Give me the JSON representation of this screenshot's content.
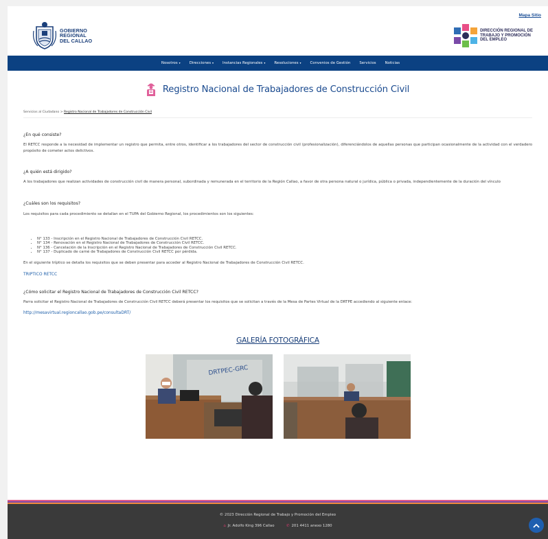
{
  "topbar": {
    "sitemap": "Mapa Sitio"
  },
  "header": {
    "left_logo": [
      "GOBIERNO",
      "REGIONAL",
      "DEL CALLAO"
    ],
    "right_logo": [
      "DIRECCIÓN REGIONAL DE",
      "TRABAJO Y PROMOCIÓN",
      "DEL EMPLEO"
    ]
  },
  "nav": [
    {
      "label": "Nosotros",
      "dropdown": true
    },
    {
      "label": "Direcciones",
      "dropdown": true
    },
    {
      "label": "Instancias Regionales",
      "dropdown": true
    },
    {
      "label": "Resoluciones",
      "dropdown": true
    },
    {
      "label": "Convenios de Gestión",
      "dropdown": false
    },
    {
      "label": "Servicios",
      "dropdown": false
    },
    {
      "label": "Noticias",
      "dropdown": false
    }
  ],
  "page": {
    "title": "Registro Nacional de Trabajadores de Construcción Civil",
    "breadcrumb_root": "Servicios al Ciudadano",
    "breadcrumb_sep": ">",
    "breadcrumb_current": "Registro Nacional de Trabajadores de Construcción Civil"
  },
  "sections": {
    "q1": "¿En qué consiste?",
    "p1": "El RETCC responde a la necesidad de implementar un registro que permita, entre otros, identificar a los trabajadores del sector de construcción civil (profesionalización), diferenciándolos de aquellas personas que participan ocasionalmente de la actividad con el verdadero propósito de cometer actos delictivos.",
    "q2": "¿A quién está dirigido?",
    "p2": "A los trabajadores que realizan actividades de construcción civil de manera personal, subordinada y remunerada en el territorio de la Región Callao, a favor de otra persona natural o jurídica, pública o privada, independientemente de la duración del vínculo",
    "q3": "¿Cuáles son los requisitos?",
    "p3": "Los requisitos para cada procedimiento se detallan en el TUPA del Gobierno Regional, los procedimientos son los siguientes:",
    "requirements": [
      "N° 133 - Inscripción en el Registro Nacional de Trabajadores de Construcción Civil RETCC.",
      "N° 134 - Renovación en el Registro Nacional de Trabajadores de Construcción Civil RETCC.",
      "N° 136 - Cancelación de la Inscripción en el Registro Nacional de Trabajadores de Construcción Civil RETCC.",
      "N° 137 - Duplicado de carné de Trabajadores de Construcción Civil RETCC por pérdida."
    ],
    "p4": "En el siguiente tríptico se detalla los requisitos que se deben presentar para acceder al Registro Nacional de Trabajadores de Construcción Civil RETCC.",
    "triptico_link": "TRIPTICO RETCC",
    "q4": "¿Cómo solicitar el Registro Nacional de Trabajadores de Construcción Civil RETCC?",
    "p5": "Parra solicitar el Registro Nacional de Trabajadores de Construcción Civil RETCC deberá presentar los requisitos que se solicitan a través de la Mesa de Partes Virtual de la DRTPE accediendo al siguiente enlace:",
    "mesa_link": "http://mesavirtual.regioncallao.gob.pe/consultaDRT/"
  },
  "gallery": {
    "title": "GALERÍA FOTOGRÁFICA",
    "photo1_sign": "DRTPEC-GRC"
  },
  "footer": {
    "copyright": "© 2023 Dirección Regional de Trabajo y Promoción del Empleo",
    "address": "Jr. Adolfo King 396 Callao",
    "phone": "201 4411 anexo 1280"
  },
  "colors": {
    "nav_bg": "#0b4182",
    "title": "#1a4a8f",
    "link": "#1a5ca8",
    "footer_bg": "#3a3a3a",
    "stripe_pink": "#e05a8a",
    "stripe_purple": "#7b4aa8",
    "stripe_orange": "#f28a3c"
  },
  "icons": {
    "title_icon": "worker-icon",
    "home": "home-icon",
    "phone": "phone-icon",
    "back_to_top": "chevron-up-icon"
  }
}
